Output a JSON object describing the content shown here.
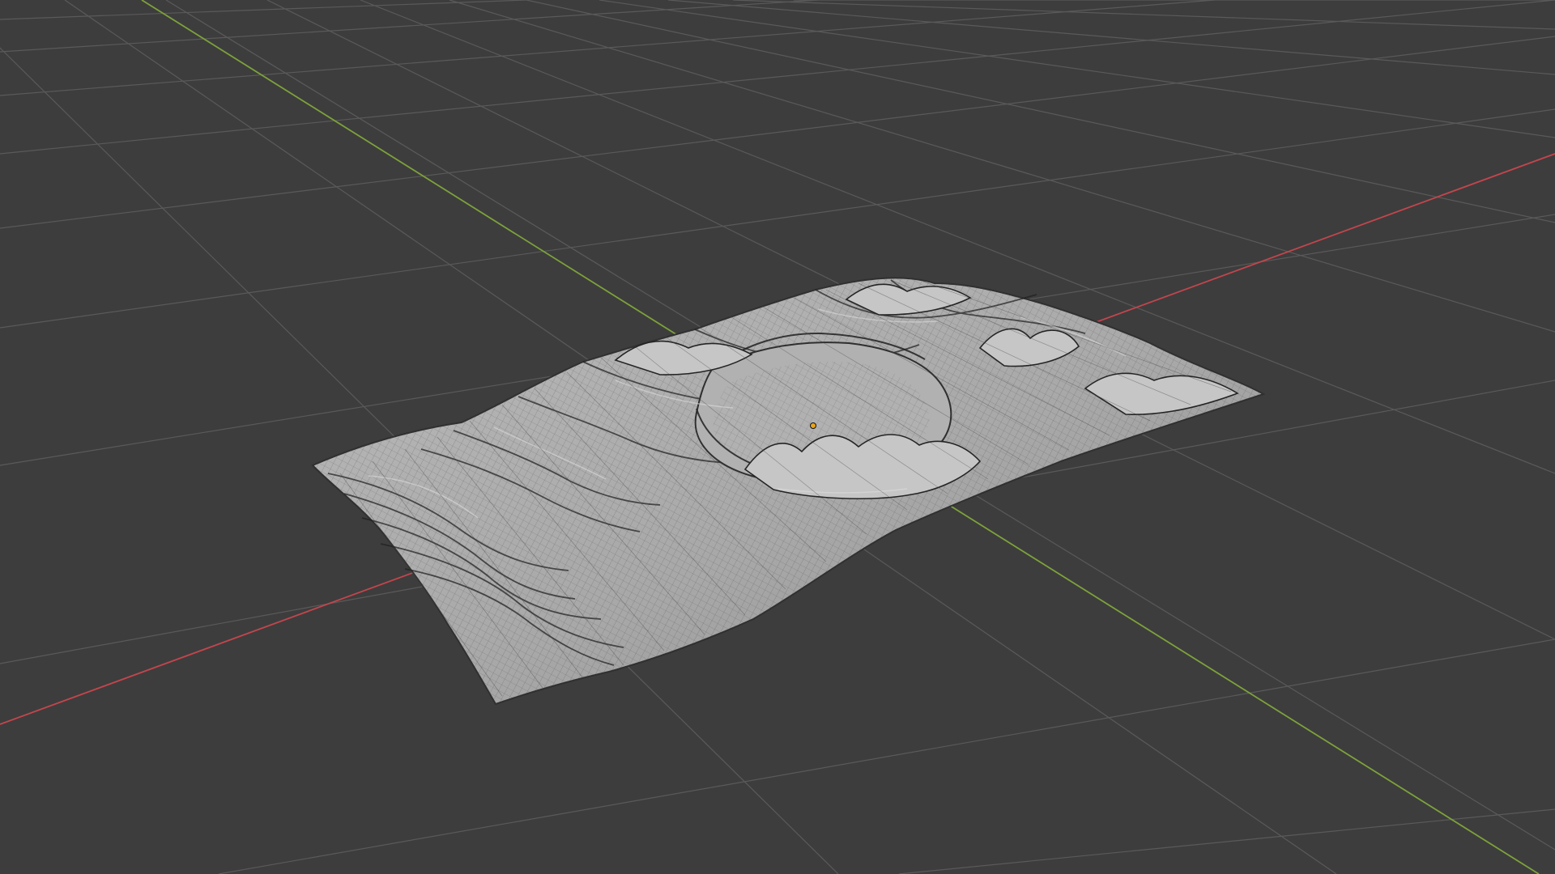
{
  "viewport": {
    "background_color": "#3d3d3d",
    "grid_color": "#5a5a5a",
    "x_axis_color": "#c4454d",
    "y_axis_color": "#7da23a",
    "terrain_fill_color": "#a9a9a9",
    "terrain_shadow_color": "#6f6f6f",
    "terrain_highlight_color": "#d8d8d8",
    "wireframe_color": "#2e2e2e",
    "origin_color": "#e8a41c"
  },
  "scene": {
    "object": "terrain-mesh",
    "display_mode": "solid-with-wireframe",
    "grid_visible": true,
    "axes_visible": [
      "x",
      "y"
    ]
  }
}
